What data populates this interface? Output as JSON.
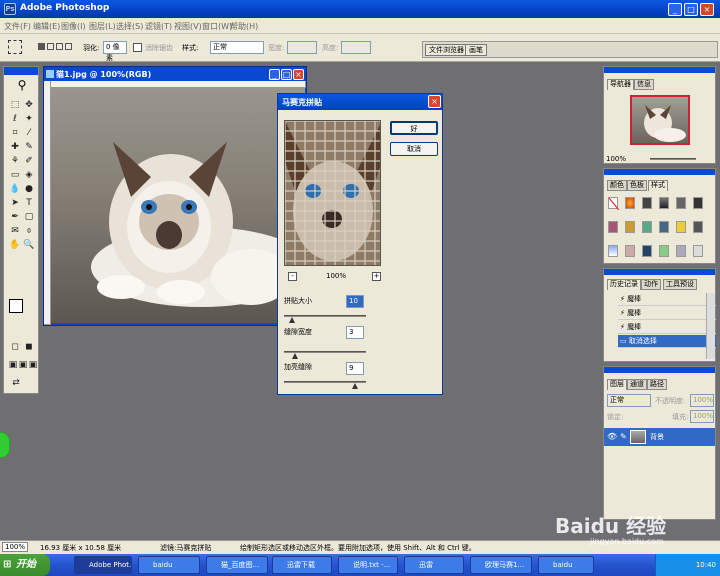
{
  "app": {
    "title": "Adobe Photoshop",
    "icon": "Ps"
  },
  "menu": [
    "文件(F)",
    "编辑(E)",
    "图像(I)",
    "图层(L)",
    "选择(S)",
    "滤镜(T)",
    "视图(V)",
    "窗口(W)",
    "帮助(H)"
  ],
  "options": {
    "feather_label": "羽化:",
    "feather_value": "0 像素",
    "antialias_label": "消除锯齿",
    "style_label": "样式:",
    "style_value": "正常",
    "width_label": "宽度:",
    "height_label": "高度:"
  },
  "palette_well": {
    "tabs": [
      "文件浏览器",
      "画笔"
    ]
  },
  "document": {
    "title": "猫1.jpg @ 100%(RGB)"
  },
  "dialog": {
    "title": "马赛克拼贴",
    "ok_label": "好",
    "cancel_label": "取消",
    "zoom": "100%",
    "minus": "-",
    "plus": "+",
    "fields": [
      {
        "label": "拼贴大小",
        "value": "10"
      },
      {
        "label": "缝隙宽度",
        "value": "3"
      },
      {
        "label": "加亮缝隙",
        "value": "9"
      }
    ]
  },
  "navigator": {
    "tabs": [
      "导航器",
      "信息"
    ],
    "zoom": "100%"
  },
  "swatches": {
    "tabs": [
      "颜色",
      "色板",
      "样式"
    ]
  },
  "history": {
    "tabs": [
      "历史记录",
      "动作",
      "工具预设"
    ],
    "items": [
      "魔棒",
      "魔棒",
      "魔棒",
      "取消选择"
    ]
  },
  "layers": {
    "tabs": [
      "图层",
      "通道",
      "路径"
    ],
    "blend": "正常",
    "opacity_label": "不透明度:",
    "opacity": "100%",
    "lock_label": "锁定:",
    "fill_label": "填充:",
    "fill": "100%",
    "layer_name": "背景"
  },
  "status": {
    "zoom": "100%",
    "size": "16.93 厘米 x 10.58 厘米",
    "filter": "滤镜:马赛克拼贴",
    "hint": "绘制矩形选区或移动选区外框。要用附加选项，使用 Shift、Alt 和 Ctrl 键。"
  },
  "taskbar": {
    "start": "开始",
    "items": [
      "Adobe Phot...",
      "baidu",
      "猫_百度图...",
      "迅雷下载",
      "说明.txt -...",
      "迅雷",
      "欧理马赛1...",
      "baidu"
    ],
    "clock": "10:40"
  },
  "watermark": {
    "brand": "Baidu 经验",
    "url": "jingyan.baidu.com"
  },
  "colors": {
    "titlebar": "#0a58e0",
    "chrome": "#ece9d8",
    "workspace": "#6e6e73",
    "selection": "#316ac5"
  }
}
